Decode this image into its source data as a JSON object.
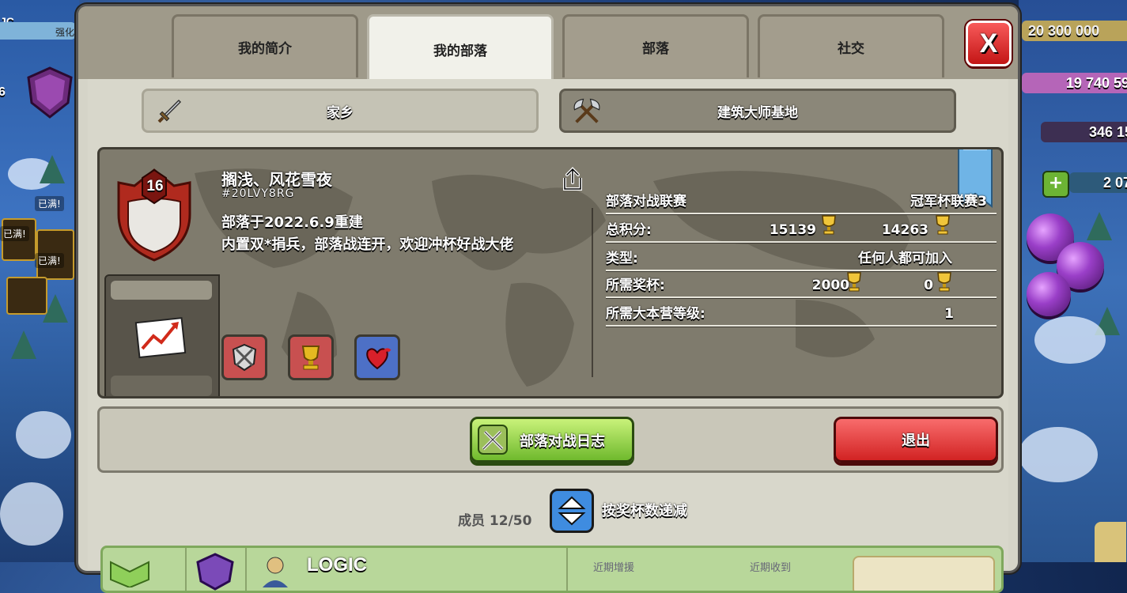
{
  "background": {
    "resources": [
      "20 300 000",
      "19 740 59",
      "346 15",
      "2 07"
    ],
    "left_counter": "6",
    "left_tag": "强化",
    "left_top": "JC.",
    "full_labels": [
      "已满!",
      "已满!",
      "已满!"
    ]
  },
  "tabs": [
    {
      "label": "我的简介",
      "active": false
    },
    {
      "label": "我的部落",
      "active": true
    },
    {
      "label": "部落",
      "active": false
    },
    {
      "label": "社交",
      "active": false
    }
  ],
  "close_label": "X",
  "subtabs": {
    "home": "家乡",
    "builder": "建筑大师基地"
  },
  "clan": {
    "level": "16",
    "name": "搁浅、风花雪夜",
    "tag": "#20LVY8RG",
    "desc_line1": "部落于2022.6.9重建",
    "desc_line2": "内置双*捐兵，部落战连开，欢迎冲杯好战大佬"
  },
  "info": {
    "war_league_label": "部落对战联赛",
    "war_league_value": "冠军杯联赛3",
    "points_label": "总积分:",
    "points_home": "15139",
    "points_builder": "14263",
    "type_label": "类型:",
    "type_value": "任何人都可加入",
    "req_trophies_label": "所需奖杯:",
    "req_trophies_home": "2000",
    "req_trophies_builder": "0",
    "req_th_label": "所需大本营等级:",
    "req_th_value": "1"
  },
  "buttons": {
    "war_log": "部落对战日志",
    "leave": "退出"
  },
  "members": {
    "count_label": "成员 12/50",
    "sort_label": "按奖杯数递减",
    "first_member_name": "LOGIC",
    "stat1": "近期增援",
    "stat2": "近期收到"
  },
  "colors": {
    "war_button": "#8ad43f",
    "leave_button": "#e83535",
    "close_button": "#e02424",
    "sort_button": "#3f8ce0"
  }
}
